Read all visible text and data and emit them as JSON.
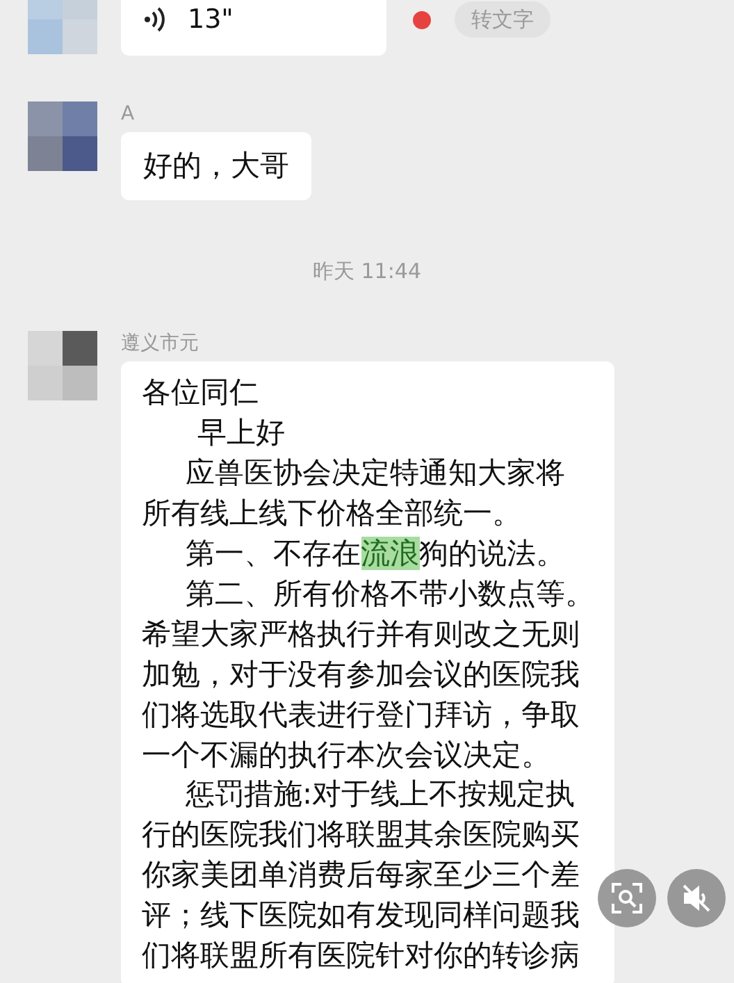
{
  "messages": [
    {
      "kind": "voice",
      "duration": "13\"",
      "unread": true,
      "action": "转文字"
    },
    {
      "kind": "text",
      "sender": "A",
      "lines": [
        {
          "kind": "plain",
          "parts": [
            {
              "text": "好的，大哥",
              "highlighted": false
            }
          ]
        }
      ]
    },
    {
      "kind": "time",
      "text": "昨天 11:44"
    },
    {
      "kind": "text",
      "sender": "遵义市元",
      "lines": [
        {
          "kind": "plain",
          "parts": [
            {
              "text": "各位同仁",
              "highlighted": false
            }
          ]
        },
        {
          "kind": "deep",
          "parts": [
            {
              "text": "早上好",
              "highlighted": false
            }
          ]
        },
        {
          "kind": "indent",
          "parts": [
            {
              "text": "应兽医协会决定特通知大家将",
              "highlighted": false
            }
          ]
        },
        {
          "kind": "plain",
          "parts": [
            {
              "text": "所有线上线下价格全部统一。",
              "highlighted": false
            }
          ]
        },
        {
          "kind": "indent",
          "parts": [
            {
              "text": "第一、不存在",
              "highlighted": false
            },
            {
              "text": "流浪",
              "highlighted": true
            },
            {
              "text": "狗的说法。",
              "highlighted": false
            }
          ]
        },
        {
          "kind": "indent",
          "parts": [
            {
              "text": "第二、所有价格不带小数点等。",
              "highlighted": false
            }
          ]
        },
        {
          "kind": "plain",
          "parts": [
            {
              "text": "希望大家严格执行并有则改之无则",
              "highlighted": false
            }
          ]
        },
        {
          "kind": "plain",
          "parts": [
            {
              "text": "加勉，对于没有参加会议的医院我",
              "highlighted": false
            }
          ]
        },
        {
          "kind": "plain",
          "parts": [
            {
              "text": "们将选取代表进行登门拜访，争取",
              "highlighted": false
            }
          ]
        },
        {
          "kind": "plain",
          "parts": [
            {
              "text": "一个不漏的执行本次会议决定。",
              "highlighted": false
            }
          ]
        },
        {
          "kind": "indent",
          "parts": [
            {
              "text": "惩罚措施:对于线上不按规定执",
              "highlighted": false
            }
          ]
        },
        {
          "kind": "plain",
          "parts": [
            {
              "text": "行的医院我们将联盟其余医院购买",
              "highlighted": false
            }
          ]
        },
        {
          "kind": "plain",
          "parts": [
            {
              "text": "你家美团单消费后每家至少三个差",
              "highlighted": false
            }
          ]
        },
        {
          "kind": "plain",
          "parts": [
            {
              "text": "评；线下医院如有发现同样问题我",
              "highlighted": false
            }
          ]
        },
        {
          "kind": "plain",
          "parts": [
            {
              "text": "们将联盟所有医院针对你的转诊病",
              "highlighted": false
            }
          ]
        }
      ]
    }
  ]
}
